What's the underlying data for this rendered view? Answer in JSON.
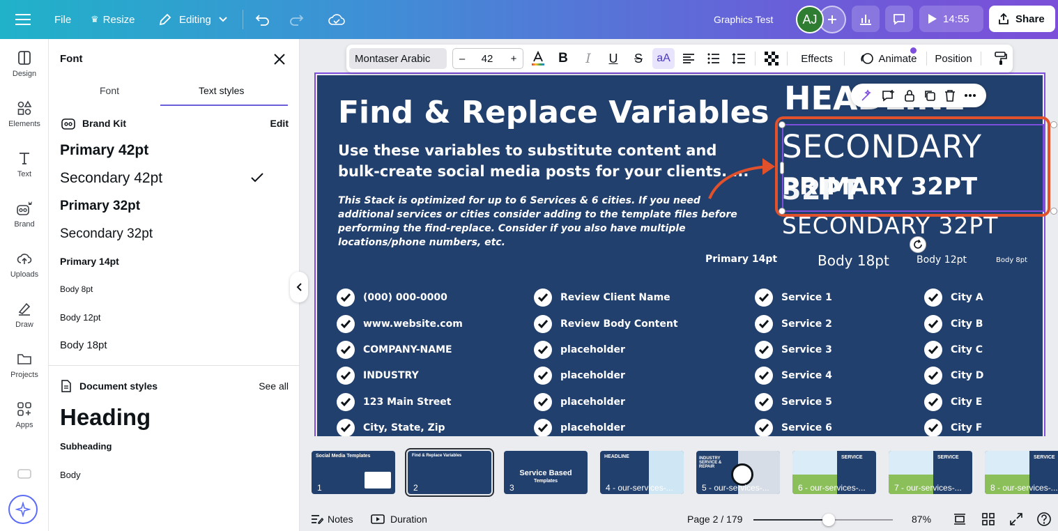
{
  "topbar": {
    "file": "File",
    "resize": "Resize",
    "editing": "Editing",
    "doc_title": "Graphics Test",
    "avatar_initials": "AJ",
    "present_time": "14:55",
    "share": "Share"
  },
  "rail": [
    {
      "label": "Design",
      "icon": "design-icon"
    },
    {
      "label": "Elements",
      "icon": "elements-icon"
    },
    {
      "label": "Text",
      "icon": "text-icon"
    },
    {
      "label": "Brand",
      "icon": "brand-icon"
    },
    {
      "label": "Uploads",
      "icon": "uploads-icon"
    },
    {
      "label": "Draw",
      "icon": "draw-icon"
    },
    {
      "label": "Projects",
      "icon": "projects-icon"
    },
    {
      "label": "Apps",
      "icon": "apps-icon"
    }
  ],
  "panel": {
    "title": "Font",
    "tabs": [
      "Font",
      "Text styles"
    ],
    "brand_kit": "Brand Kit",
    "edit": "Edit",
    "styles": [
      "Primary 42pt",
      "Secondary 42pt",
      "Primary 32pt",
      "Secondary 32pt",
      "Primary 14pt",
      "Body 8pt",
      "Body 12pt",
      "Body 18pt"
    ],
    "selected_style": "Secondary 42pt",
    "document_styles": "Document styles",
    "see_all": "See all",
    "doc_styles": [
      "Heading",
      "Subheading",
      "Body"
    ]
  },
  "text_toolbar": {
    "font": "Montaser Arabic",
    "size": "42",
    "effects": "Effects",
    "animate": "Animate",
    "position": "Position"
  },
  "design": {
    "title": "Find & Replace Variables",
    "subtitle": "Use these variables to substitute content and bulk-create social media posts for your clients. ...",
    "note": "This Stack is optimized for up to 6 Services & 6 cities. If you need additional services or cities consider adding to the template files before performing the find-replace. Consider if you also have multiple locations/phone numbers, etc.",
    "headline": "HEADLINE",
    "secondary42": "SECONDARY",
    "primary32": "PRIMARY 32PT",
    "ghost32": "32PT",
    "secondary32": "SECONDARY 32PT",
    "primary14": "Primary 14pt",
    "body18": "Body 18pt",
    "body12": "Body 12pt",
    "body8": "Body 8pt",
    "col1": [
      "(000) 000-0000",
      "www.website.com",
      "COMPANY-NAME",
      "INDUSTRY",
      "123 Main Street",
      "City, State, Zip"
    ],
    "col2": [
      "Review Client Name",
      "Review Body Content",
      "placeholder",
      "placeholder",
      "placeholder",
      "placeholder"
    ],
    "col3": [
      "Service 1",
      "Service 2",
      "Service 3",
      "Service 4",
      "Service 5",
      "Service 6"
    ],
    "col4": [
      "City A",
      "City B",
      "City C",
      "City D",
      "City E",
      "City F"
    ]
  },
  "thumbnails": [
    {
      "num": "1",
      "text": "Social Media Templates"
    },
    {
      "num": "2",
      "text": "Find & Replace Variables"
    },
    {
      "num": "3",
      "text": "Service Based",
      "sub": "Templates"
    },
    {
      "num": "4 - our-services-...",
      "text": "HEADLINE"
    },
    {
      "num": "5 - our-services-...",
      "text": "INDUSTRY SERVICE & REPAIR"
    },
    {
      "num": "6 - our-services-...",
      "text": "SERVICE"
    },
    {
      "num": "7 - our-services-...",
      "text": "SERVICE"
    },
    {
      "num": "8 - our-services-...",
      "text": "SERVICE"
    }
  ],
  "bottombar": {
    "notes": "Notes",
    "duration": "Duration",
    "page": "Page 2 / 179",
    "zoom_percent": 87,
    "zoom_label": "87%",
    "zoom_slider_fraction": 0.54
  },
  "colors": {
    "accent": "#7d4fdc",
    "design_bg": "#22406d",
    "highlight": "#e1522c"
  }
}
